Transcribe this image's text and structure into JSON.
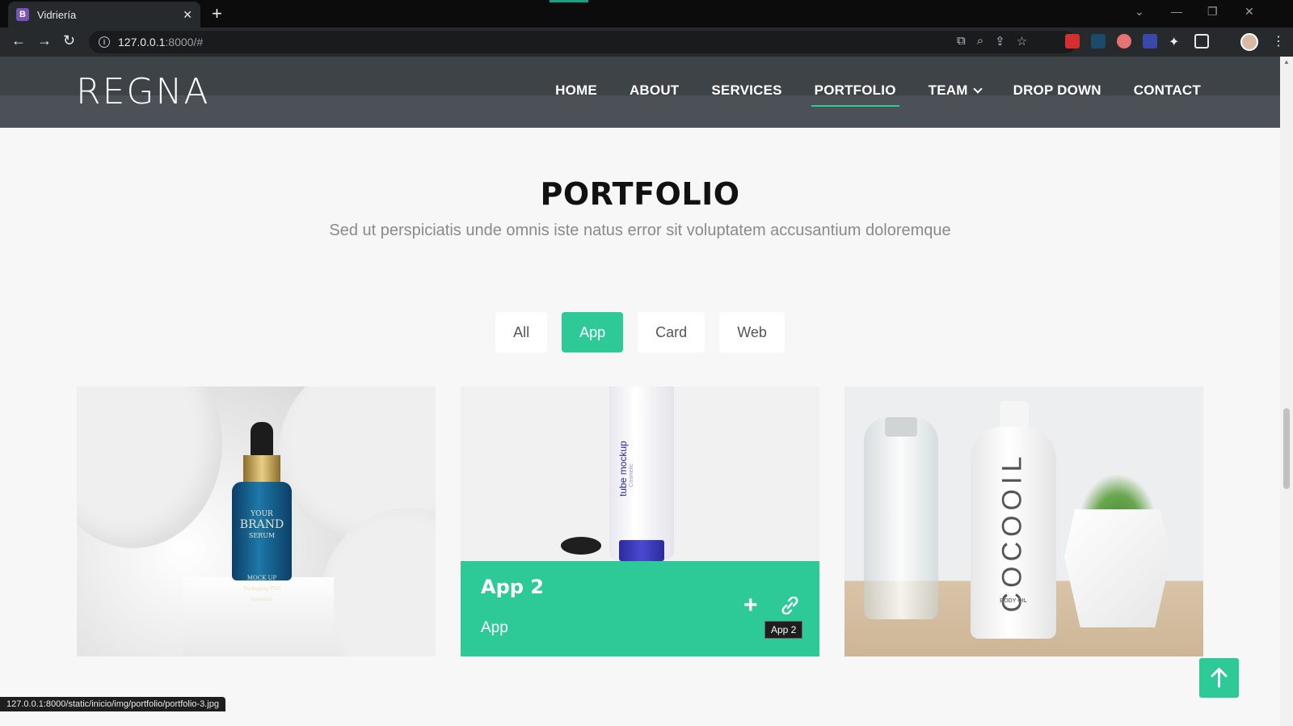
{
  "browser": {
    "tab_title": "Vidriería",
    "tab_favicon": "B",
    "close_tab": "✕",
    "new_tab": "+",
    "url_host": "127.0.0.1",
    "url_path": ":8000/#",
    "status_url": "127.0.0.1:8000/static/inicio/img/portfolio/portfolio-3.jpg"
  },
  "site": {
    "logo": "REGNA",
    "nav": [
      "HOME",
      "ABOUT",
      "SERVICES",
      "PORTFOLIO",
      "TEAM",
      "DROP DOWN",
      "CONTACT"
    ],
    "active_nav": "PORTFOLIO",
    "accent_color": "#2dc997"
  },
  "portfolio": {
    "title": "PORTFOLIO",
    "subtitle": "Sed ut perspiciatis unde omnis iste natus error sit voluptatem accusantium doloremque",
    "filters": [
      "All",
      "App",
      "Card",
      "Web"
    ],
    "active_filter": "App",
    "items": [
      {
        "image_text": {
          "line1": "YOUR",
          "line2": "BRAND",
          "line3": "SERUM",
          "foot1": "MOCK UP",
          "foot2": "Packaging PSD template"
        }
      },
      {
        "title": "App 2",
        "category": "App",
        "tooltip": "App 2",
        "image_text": "tube mockup",
        "image_subtext": "Cosmetic"
      },
      {
        "image_text": "COCOOIL",
        "image_subtext": "BODY OIL"
      }
    ]
  }
}
